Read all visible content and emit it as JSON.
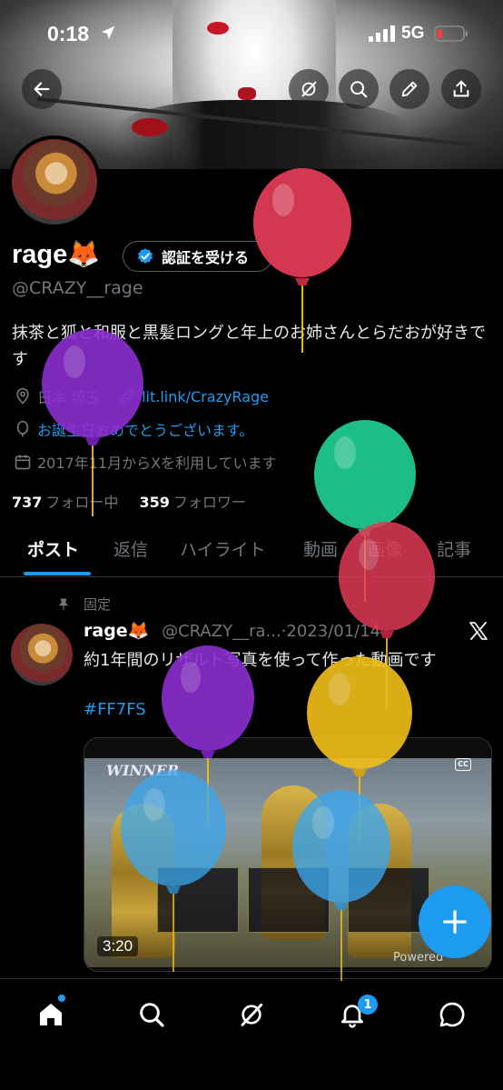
{
  "status_bar": {
    "time": "0:18",
    "network": "5G"
  },
  "profile": {
    "name": "rage🦊",
    "verify_button": "認証を受ける",
    "handle": "@CRAZY__rage",
    "bio": "抹茶と狐と和服と黒髪ロングと年上のお姉さんとらだおが好きです",
    "location": "日本 埼玉",
    "link": "lit.link/CrazyRage",
    "birthday": "お誕生日おめでとうございます。",
    "joined": "2017年11月からXを利用しています",
    "following_count": "737",
    "following_label": "フォロー中",
    "followers_count": "359",
    "followers_label": "フォロワー"
  },
  "tabs": [
    {
      "label": "ポスト",
      "active": true
    },
    {
      "label": "返信"
    },
    {
      "label": "ハイライト"
    },
    {
      "label": "動画"
    },
    {
      "label": "画像"
    },
    {
      "label": "記事"
    }
  ],
  "post": {
    "pinned_label": "固定",
    "name": "rage🦊",
    "handle_date": "@CRAZY__ra...·2023/01/14",
    "text": "約1年間のリザルト写真を使って作った動画です",
    "hashtag": "#FF7FS",
    "media": {
      "overlay_title": "WINNER",
      "duration": "3:20",
      "watermark": "Powered",
      "cc_label": "CC"
    }
  },
  "nav": {
    "notification_badge": "1"
  },
  "colors": {
    "accent": "#1d9bf0",
    "background": "#000000",
    "secondary_text": "#71767b",
    "balloon_red": "#e03a55",
    "balloon_purple": "#8b2fd1",
    "balloon_green": "#1ec98e",
    "balloon_yellow": "#f2c01a",
    "balloon_blue": "#3aa7f0"
  }
}
